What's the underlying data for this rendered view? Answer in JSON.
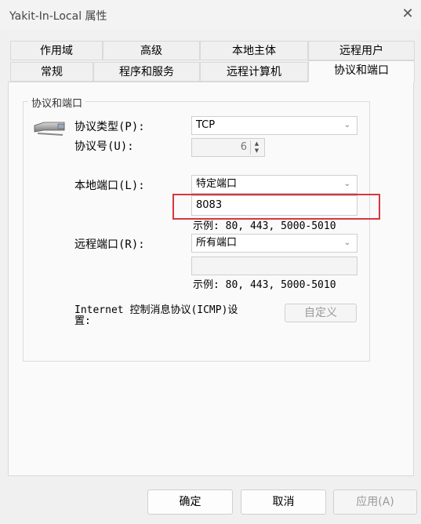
{
  "window": {
    "title": "Yakit-In-Local 属性",
    "close_glyph": "✕"
  },
  "tabs_row1": [
    "作用域",
    "高级",
    "本地主体",
    "远程用户"
  ],
  "tabs_row2": [
    "常规",
    "程序和服务",
    "远程计算机",
    "协议和端口"
  ],
  "active_tab": "协议和端口",
  "group": {
    "title": "协议和端口"
  },
  "protocol": {
    "type_label": "协议类型(P):",
    "type_value": "TCP",
    "number_label": "协议号(U):",
    "number_value": "6"
  },
  "local_port": {
    "label": "本地端口(L):",
    "mode": "特定端口",
    "value": "8083",
    "example": "示例: 80, 443, 5000-5010"
  },
  "remote_port": {
    "label": "远程端口(R):",
    "mode": "所有端口",
    "value": "",
    "example": "示例: 80, 443, 5000-5010"
  },
  "icmp": {
    "label_line1": "Internet 控制消息协议(ICMP)设",
    "label_line2": "置:",
    "button": "自定义"
  },
  "footer": {
    "ok": "确定",
    "cancel": "取消",
    "apply": "应用(A)"
  },
  "icons": {
    "protocol": "network-plug-icon",
    "dropdown": "chevron-down-icon"
  }
}
